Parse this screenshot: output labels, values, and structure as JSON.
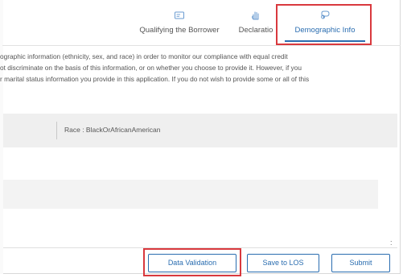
{
  "tabs": [
    {
      "label": "Qualifying the Borrower",
      "icon": "id-card-icon"
    },
    {
      "label": "Declaratio",
      "icon": "hand-icon"
    },
    {
      "label": "Demographic Info",
      "icon": "chat-bubble-icon",
      "active": true
    }
  ],
  "intro": {
    "line1": "ographic information (ethnicity, sex, and race) in order to monitor our compliance with equal credit",
    "line2": "ot discriminate on the basis of this information, or on whether you choose to provide it. However, if you",
    "line3": "r marital status information you provide in this application. If you do not wish to provide some or all of this"
  },
  "race_summary": "Race : BlackOrAfricanAmerican",
  "menu_dots": ":",
  "footer": {
    "data_validation": "Data Validation",
    "save_to_los": "Save to LOS",
    "submit": "Submit"
  },
  "colors": {
    "accent": "#2a6db0",
    "highlight": "#d9393e"
  }
}
